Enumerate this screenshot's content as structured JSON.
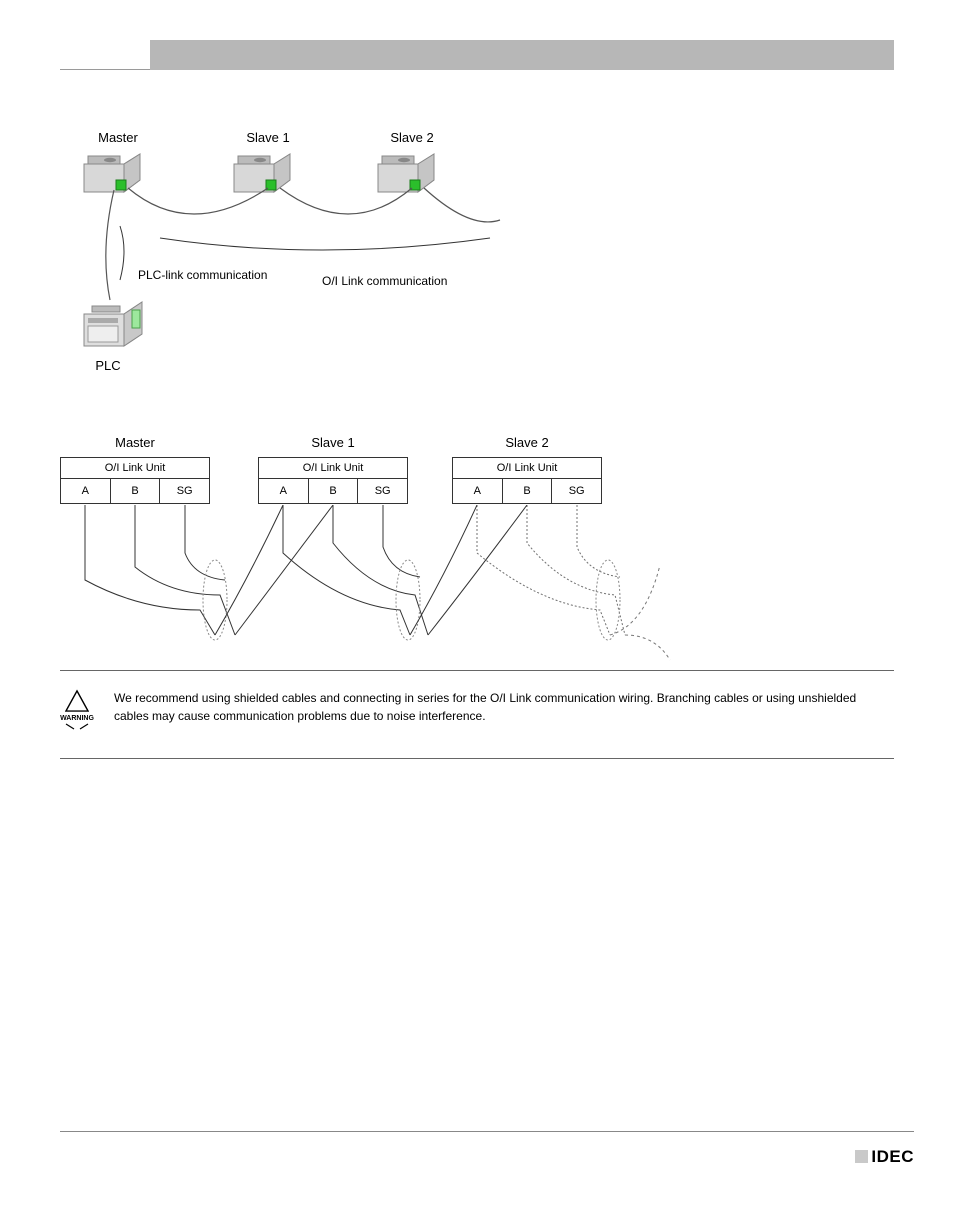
{
  "diagram1": {
    "master": "Master",
    "slave1": "Slave 1",
    "slave2": "Slave 2",
    "plc": "PLC",
    "plc_link": "PLC-link communication",
    "oi_link": "O/I Link communication"
  },
  "diagram2": {
    "master": "Master",
    "slave1": "Slave 1",
    "slave2": "Slave 2",
    "unit_title": "O/I Link Unit",
    "terminals": {
      "a": "A",
      "b": "B",
      "sg": "SG"
    }
  },
  "warning": {
    "label": "WARNING",
    "text": "We recommend using shielded cables and connecting in series for the O/I Link communication wiring. Branching cables or using unshielded cables may cause communication problems due to noise interference."
  },
  "footer": {
    "logo": "IDEC"
  }
}
